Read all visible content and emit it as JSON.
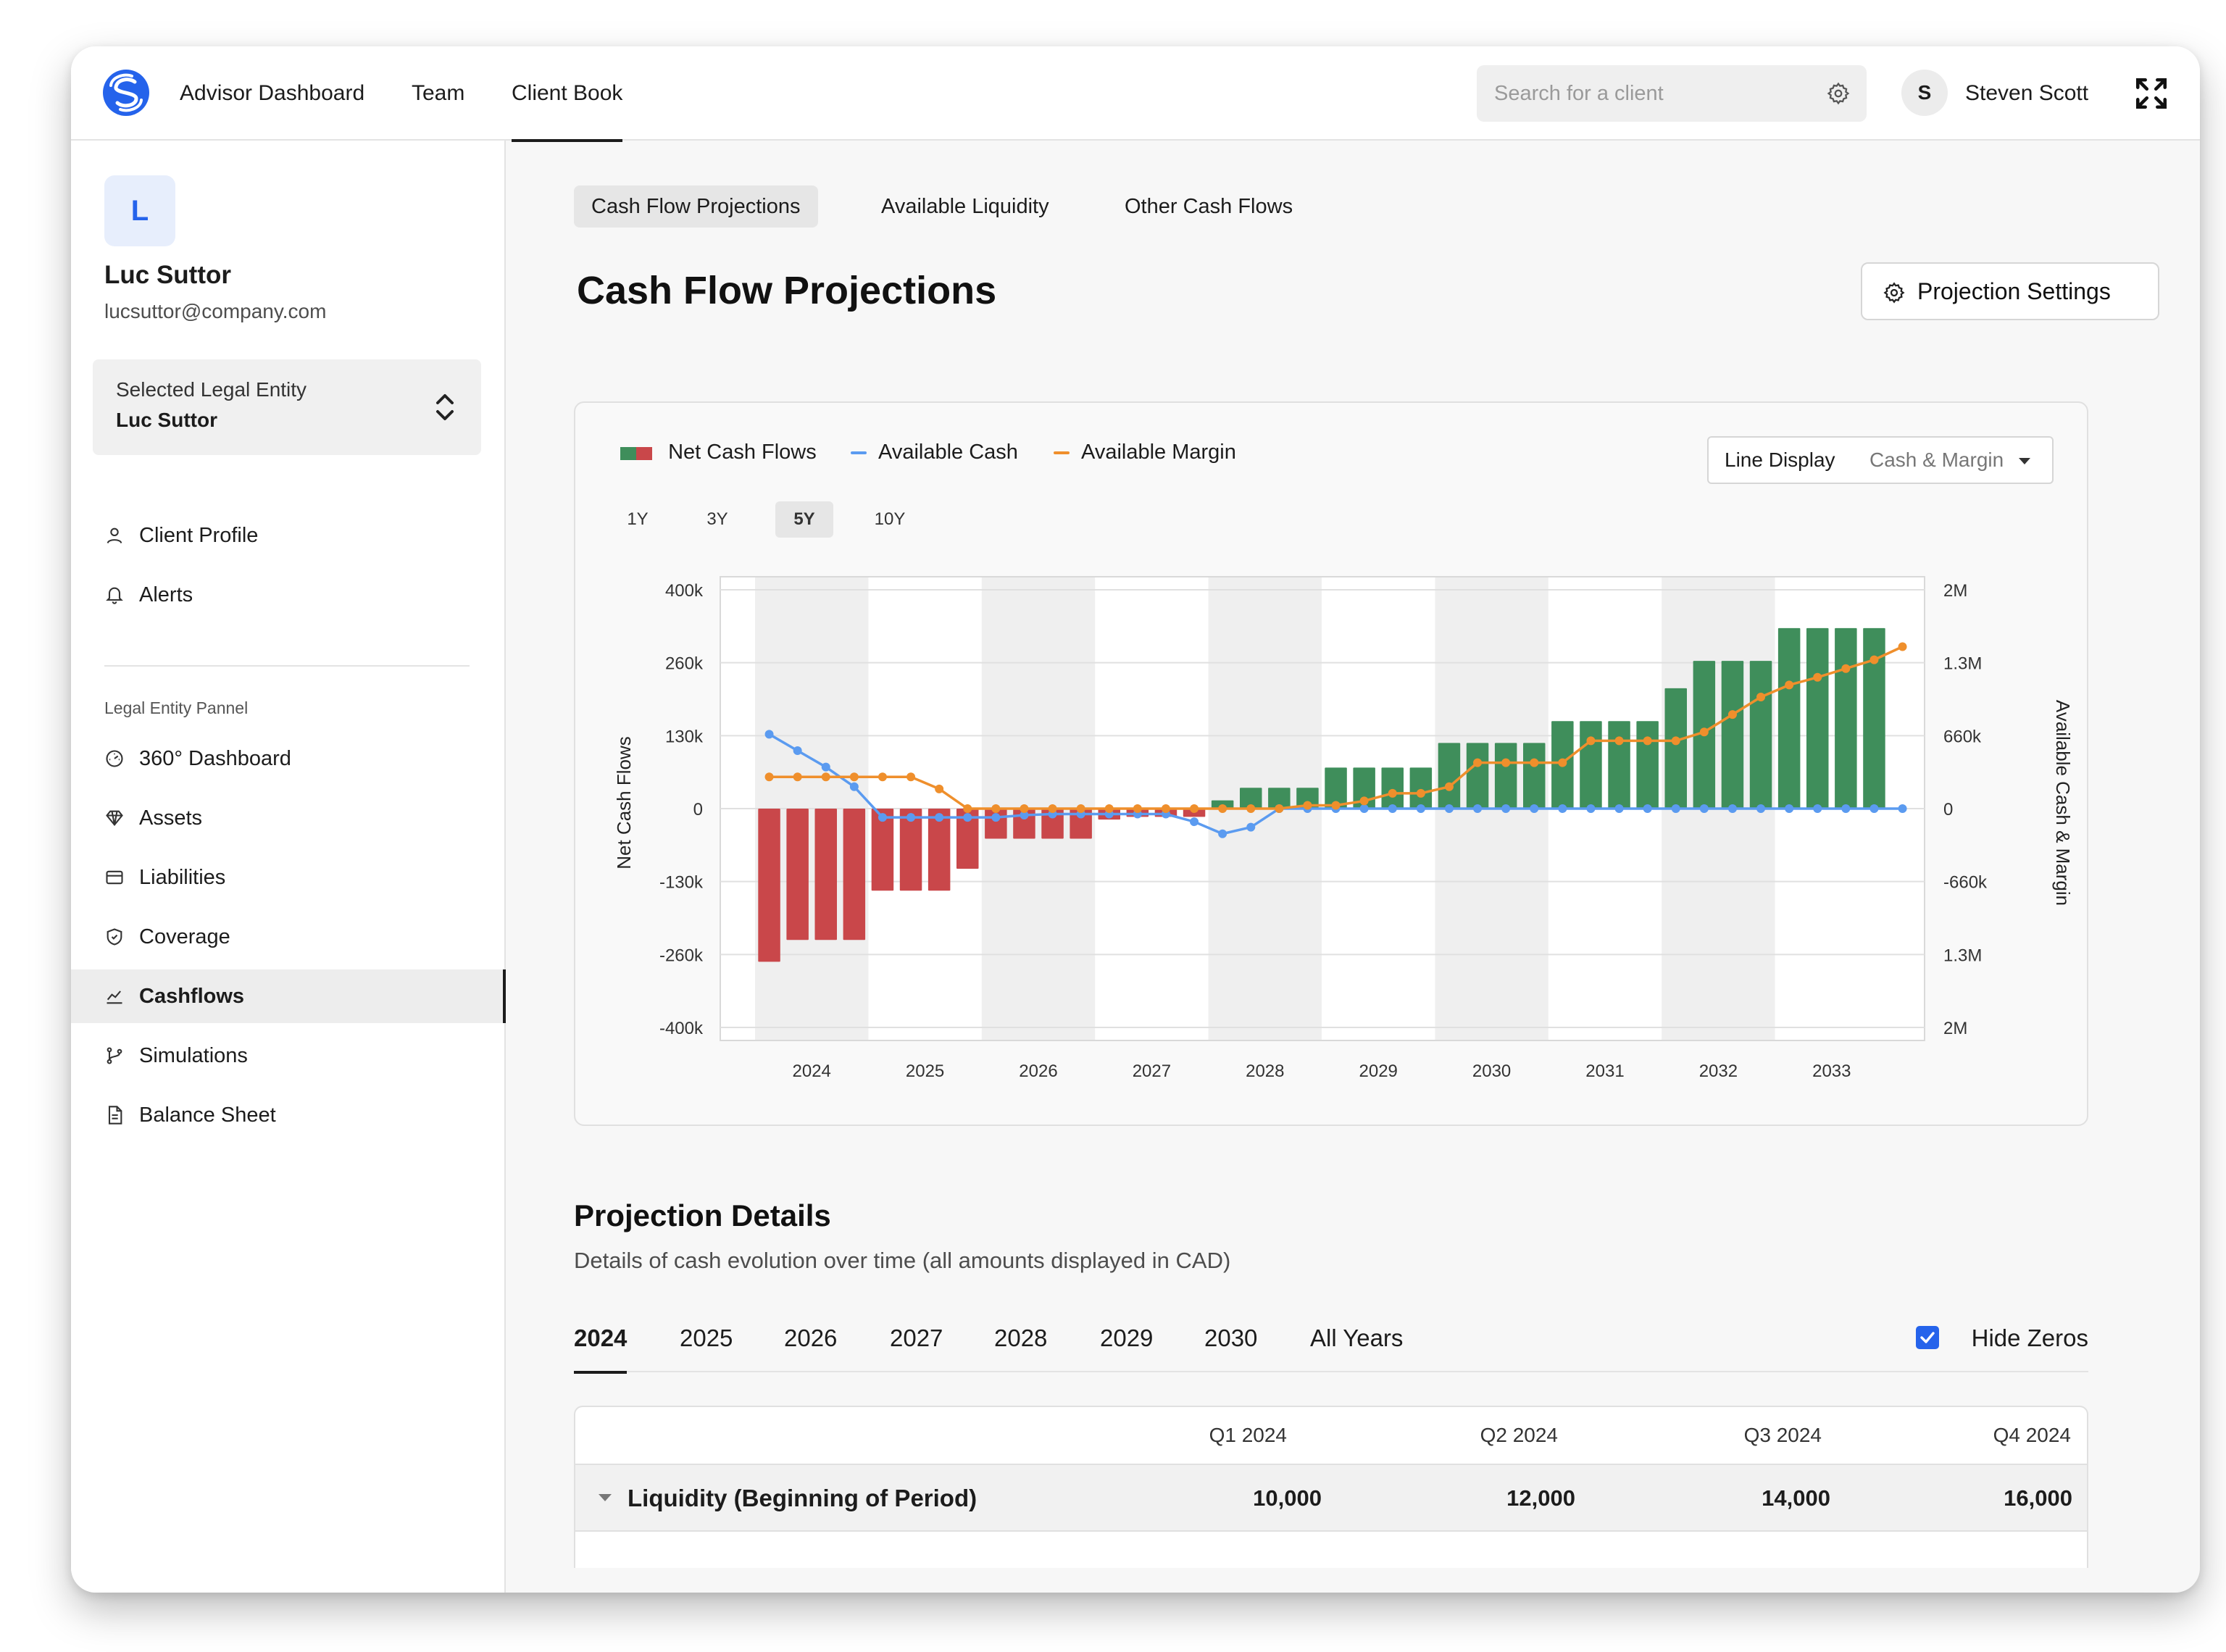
{
  "nav": {
    "items": [
      "Advisor Dashboard",
      "Team",
      "Client Book"
    ],
    "active": "Client Book",
    "search_placeholder": "Search for a client",
    "user_initial": "S",
    "user_name": "Steven Scott"
  },
  "sidebar": {
    "client_initial": "L",
    "client_name": "Luc Suttor",
    "client_email": "lucsuttor@company.com",
    "entity_label": "Selected Legal Entity",
    "entity_value": "Luc Suttor",
    "top_items": [
      {
        "label": "Client Profile",
        "icon": "user-icon"
      },
      {
        "label": "Alerts",
        "icon": "bell-icon"
      }
    ],
    "section_label": "Legal Entity Pannel",
    "items": [
      {
        "label": "360° Dashboard",
        "icon": "gauge-icon"
      },
      {
        "label": "Assets",
        "icon": "diamond-icon"
      },
      {
        "label": "Liabilities",
        "icon": "credit-card-icon"
      },
      {
        "label": "Coverage",
        "icon": "shield-icon"
      },
      {
        "label": "Cashflows",
        "icon": "chart-line-icon",
        "active": true
      },
      {
        "label": "Simulations",
        "icon": "branch-icon"
      },
      {
        "label": "Balance Sheet",
        "icon": "document-icon"
      }
    ]
  },
  "subtabs": [
    "Cash Flow Projections",
    "Available Liquidity",
    "Other Cash Flows"
  ],
  "page": {
    "title": "Cash Flow Projections",
    "settings_button": "Projection Settings"
  },
  "chart_controls": {
    "legend": [
      "Net Cash Flows",
      "Available Cash",
      "Available Margin"
    ],
    "line_display_label": "Line Display",
    "line_display_value": "Cash & Margin",
    "ranges": [
      "1Y",
      "3Y",
      "5Y",
      "10Y"
    ],
    "active_range": "5Y"
  },
  "colors": {
    "positive_bar": "#3f8e5b",
    "negative_bar": "#c9474a",
    "available_cash": "#5b9bf0",
    "available_margin": "#ef8f2c",
    "accent": "#2563eb"
  },
  "chart_data": {
    "type": "bar",
    "xlabel": "",
    "ylabel": "Net Cash Flows",
    "y2label": "Available Cash & Margin",
    "categories": [
      "2024",
      "2025",
      "2026",
      "2027",
      "2028",
      "2029",
      "2030",
      "2031",
      "2032",
      "2033"
    ],
    "y_ticks": [
      "400k",
      "260k",
      "130k",
      "0",
      "-130k",
      "-260k",
      "-400k"
    ],
    "y2_ticks": [
      "2M",
      "1.3M",
      "660k",
      "0",
      "-660k",
      "1.3M",
      "2M"
    ],
    "ylim": [
      -400000,
      400000
    ],
    "y2lim": [
      -2000000,
      2000000
    ],
    "shaded_years": [
      "2024",
      "2026",
      "2028",
      "2030",
      "2032"
    ],
    "points_per_year": 4,
    "series": [
      {
        "name": "Net Cash Flows",
        "kind": "bar",
        "values": [
          -280000,
          -240000,
          -240000,
          -240000,
          -150000,
          -150000,
          -150000,
          -110000,
          -55000,
          -55000,
          -55000,
          -55000,
          -20000,
          -15000,
          -15000,
          -15000,
          15000,
          38000,
          38000,
          38000,
          75000,
          75000,
          75000,
          75000,
          120000,
          120000,
          120000,
          120000,
          160000,
          160000,
          160000,
          160000,
          220000,
          270000,
          270000,
          270000,
          330000,
          330000,
          330000,
          330000
        ]
      },
      {
        "name": "Available Cash",
        "kind": "line",
        "values": [
          680000,
          530000,
          380000,
          200000,
          -80000,
          -80000,
          -80000,
          -80000,
          -80000,
          -60000,
          -50000,
          -50000,
          -50000,
          -50000,
          -50000,
          -120000,
          -230000,
          -170000,
          0,
          0,
          0,
          0,
          0,
          0,
          0,
          0,
          0,
          0,
          0,
          0,
          0,
          0,
          0,
          0,
          0,
          0,
          0,
          0,
          0,
          0,
          0
        ]
      },
      {
        "name": "Available Margin",
        "kind": "line",
        "values": [
          290000,
          290000,
          290000,
          290000,
          290000,
          290000,
          180000,
          0,
          0,
          0,
          0,
          0,
          0,
          0,
          0,
          0,
          0,
          0,
          0,
          30000,
          30000,
          70000,
          140000,
          140000,
          200000,
          420000,
          420000,
          420000,
          420000,
          620000,
          620000,
          620000,
          620000,
          700000,
          860000,
          1020000,
          1130000,
          1200000,
          1280000,
          1360000,
          1480000
        ]
      }
    ]
  },
  "details": {
    "title": "Projection Details",
    "subtitle": "Details of cash evolution over time (all amounts displayed in CAD)",
    "year_tabs": [
      "2024",
      "2025",
      "2026",
      "2027",
      "2028",
      "2029",
      "2030",
      "All Years"
    ],
    "active_year": "2024",
    "hide_zeros_label": "Hide Zeros",
    "hide_zeros_checked": true,
    "table": {
      "headers": [
        "Q1 2024",
        "Q2 2024",
        "Q3 2024",
        "Q4 2024"
      ],
      "rows": [
        {
          "label": "Liquidity (Beginning of Period)",
          "values": [
            "10,000",
            "12,000",
            "14,000",
            "16,000"
          ]
        }
      ]
    }
  }
}
